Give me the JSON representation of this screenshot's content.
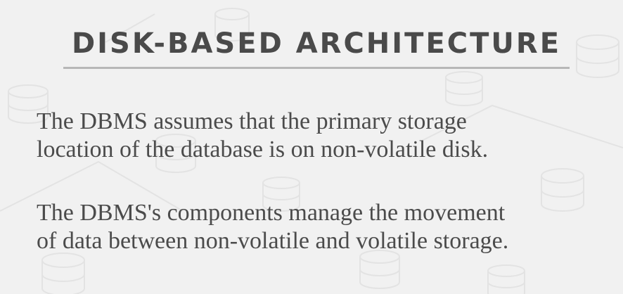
{
  "slide": {
    "title": "DISK-BASED ARCHITECTURE",
    "paragraphs": [
      {
        "lines": [
          "The DBMS assumes that the primary storage",
          "location of the database is on non-volatile disk."
        ]
      },
      {
        "lines": [
          "The DBMS's components manage the movement",
          "of data between non-volatile and volatile storage."
        ]
      }
    ]
  },
  "colors": {
    "background": "#f1f1f1",
    "title": "#4a4a4a",
    "rule": "#b7b7b7",
    "body_text": "#4b4b4b",
    "pattern": "#e6e6e6"
  },
  "icons": [
    "database-cylinder-icon"
  ]
}
